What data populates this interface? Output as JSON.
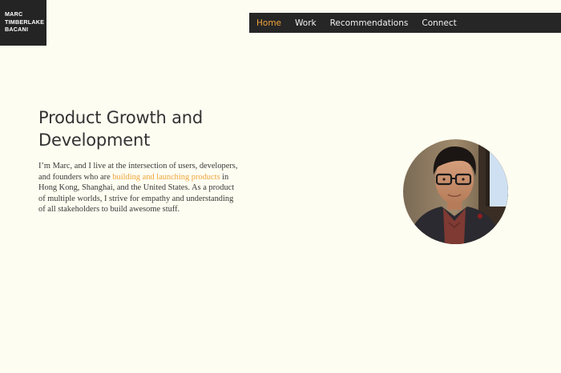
{
  "site": {
    "logo_lines": [
      "MARC",
      "TIMBERLAKE",
      "BACANI"
    ]
  },
  "nav": {
    "items": [
      {
        "label": "Home",
        "active": true
      },
      {
        "label": "Work",
        "active": false
      },
      {
        "label": "Recommendations",
        "active": false
      },
      {
        "label": "Connect",
        "active": false
      }
    ]
  },
  "hero": {
    "heading_lines": [
      "Product Growth and",
      "Development"
    ],
    "intro_before_link": "I’m Marc, and I live at the intersection of users, developers, and founders who are ",
    "intro_link": "building and launching products",
    "intro_after_link": " in Hong Kong, Shanghai, and the United States. As a product of multiple worlds, I strive for empathy and understanding of all stakeholders to build awesome stuff."
  },
  "colors": {
    "background": "#fdfdf1",
    "dark": "#262626",
    "accent": "#f0a43c",
    "text": "#333333"
  }
}
